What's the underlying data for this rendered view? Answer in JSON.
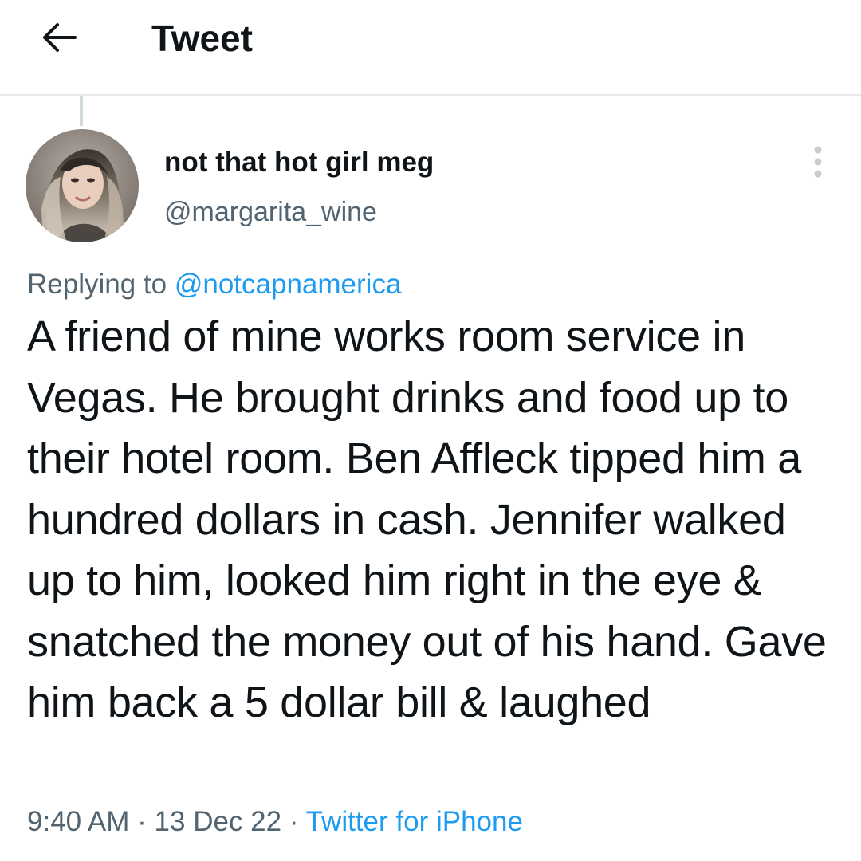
{
  "header": {
    "title": "Tweet",
    "back_icon": "arrow-left-icon"
  },
  "tweet": {
    "author": {
      "display_name": "not that hot girl meg",
      "handle": "@margarita_wine"
    },
    "reply": {
      "prefix": "Replying to",
      "target": "@notcapnamerica"
    },
    "text": "A friend of mine works room service in Vegas. He brought drinks and food up to their hotel room. Ben Affleck tipped him a hundred dollars in cash. Jennifer walked up to him, looked him right in the eye & snatched the money out of his hand. Gave him back a 5 dollar bill & laughed",
    "meta": {
      "time": "9:40 AM",
      "separator": "·",
      "date": "13 Dec 22",
      "source": "Twitter for iPhone"
    }
  },
  "colors": {
    "text_primary": "#0f1419",
    "text_secondary": "#536471",
    "accent": "#1d9bf0",
    "divider": "#e7e9ea"
  }
}
